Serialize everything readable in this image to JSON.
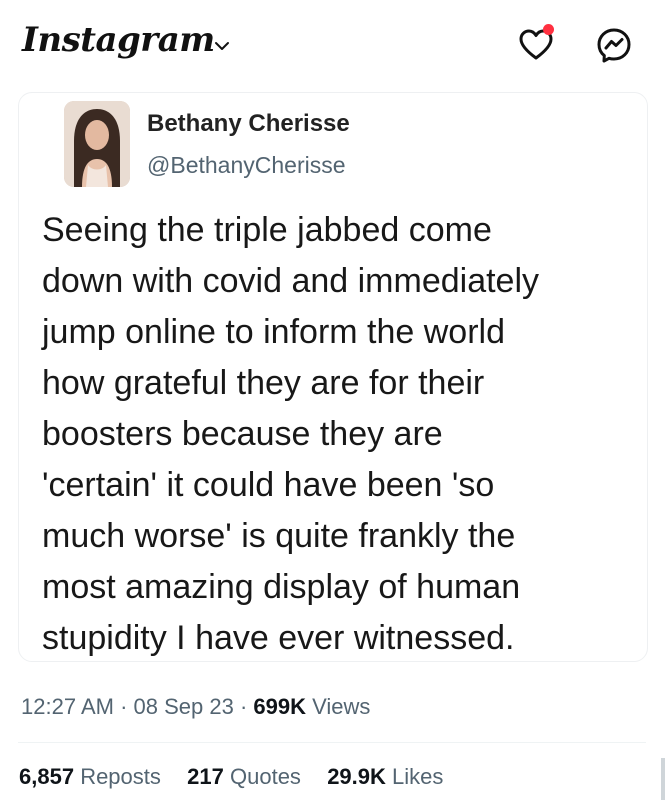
{
  "header": {
    "app_name": "Instagram",
    "icons": [
      "chevron-down-icon",
      "heart-icon",
      "messenger-icon"
    ],
    "accent_colors": {
      "notification_dot": "#ff3040"
    }
  },
  "tweet": {
    "author_name": "Bethany Cherisse",
    "author_handle": "@BethanyCherisse",
    "text_lines": [
      "Seeing the triple jabbed come",
      "down with covid and immediately",
      "jump online to inform the world",
      "how grateful they are for their",
      "boosters because they are",
      "'certain' it could have been 'so",
      "much worse' is quite frankly the",
      "most amazing display of human",
      "stupidity I have ever witnessed."
    ],
    "time": "12:27 AM",
    "date": "08 Sep 23",
    "views_count": "699K",
    "views_label": "Views",
    "separator": "·",
    "reposts_count": "6,857",
    "reposts_label": "Reposts",
    "quotes_count": "217",
    "quotes_label": "Quotes",
    "likes_count": "29.9K",
    "likes_label": "Likes"
  }
}
